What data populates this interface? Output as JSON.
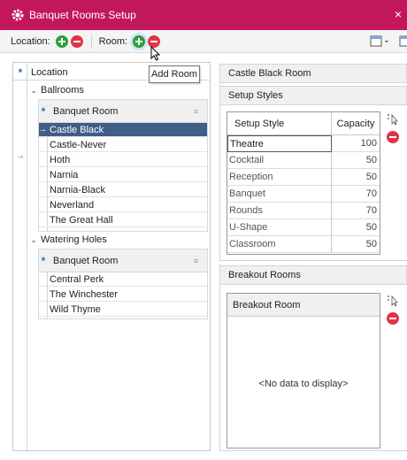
{
  "window": {
    "title": "Banquet Rooms Setup",
    "close_glyph": "×"
  },
  "toolbar": {
    "location_label": "Location:",
    "room_label": "Room:",
    "tooltip": "Add Room"
  },
  "left_panel": {
    "header": "Location",
    "groups": [
      {
        "name": "Ballrooms",
        "column_header": "Banquet Room",
        "rooms": [
          "Castle Black",
          "Castle-Never",
          "Hoth",
          "Narnia",
          "Narnia-Black",
          "Neverland",
          "The Great Hall"
        ],
        "selected_index": 0
      },
      {
        "name": "Watering Holes",
        "column_header": "Banquet Room",
        "rooms": [
          "Central Perk",
          "The Winchester",
          "Wild Thyme"
        ]
      }
    ]
  },
  "right_panel": {
    "room_title": "Castle Black Room",
    "setup_styles_header": "Setup Styles",
    "setup_styles_columns": [
      "Setup Style",
      "Capacity"
    ],
    "setup_styles_rows": [
      {
        "style": "Theatre",
        "capacity": "100"
      },
      {
        "style": "Cocktail",
        "capacity": "50"
      },
      {
        "style": "Reception",
        "capacity": "50"
      },
      {
        "style": "Banquet",
        "capacity": "70"
      },
      {
        "style": "Rounds",
        "capacity": "70"
      },
      {
        "style": "U-Shape",
        "capacity": "50"
      },
      {
        "style": "Classroom",
        "capacity": "50"
      }
    ],
    "breakout_header": "Breakout Rooms",
    "breakout_column": "Breakout Room",
    "breakout_empty": "<No data to display>"
  },
  "colors": {
    "titlebar": "#c2185b",
    "selection": "#3f5e8a",
    "add": "#2e9e3e",
    "remove": "#e0344a"
  }
}
